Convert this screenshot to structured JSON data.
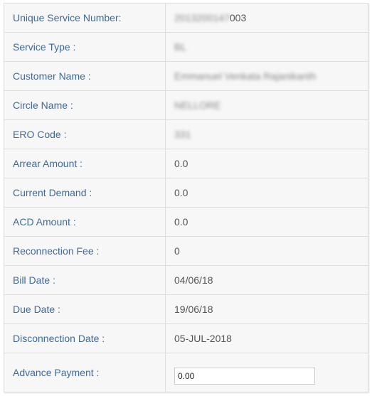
{
  "rows": [
    {
      "label": "Unique Service Number:",
      "value_hidden": "[redacted]",
      "value": "003"
    },
    {
      "label": "Service Type :",
      "value_hidden": "[redacted]"
    },
    {
      "label": "Customer Name :",
      "value_hidden": "[redacted]"
    },
    {
      "label": "Circle Name :",
      "value_hidden": "[redacted]"
    },
    {
      "label": "ERO Code :",
      "value_hidden": "[redacted]"
    },
    {
      "label": "Arrear Amount :",
      "value": "0.0"
    },
    {
      "label": "Current Demand :",
      "value": "0.0"
    },
    {
      "label": "ACD Amount :",
      "value": "0.0"
    },
    {
      "label": "Reconnection Fee :",
      "value": "0"
    },
    {
      "label": "Bill Date :",
      "value": "04/06/18"
    },
    {
      "label": "Due Date :",
      "value": "19/06/18"
    },
    {
      "label": "Disconnection Date :",
      "value": "05-JUL-2018"
    },
    {
      "label": "Advance Payment :",
      "input_value": "0.00"
    }
  ],
  "blur_placeholders": [
    "2013200147",
    "BL",
    "Emmanuel Venkata Rajanikanth",
    "NELLORE",
    "331"
  ]
}
